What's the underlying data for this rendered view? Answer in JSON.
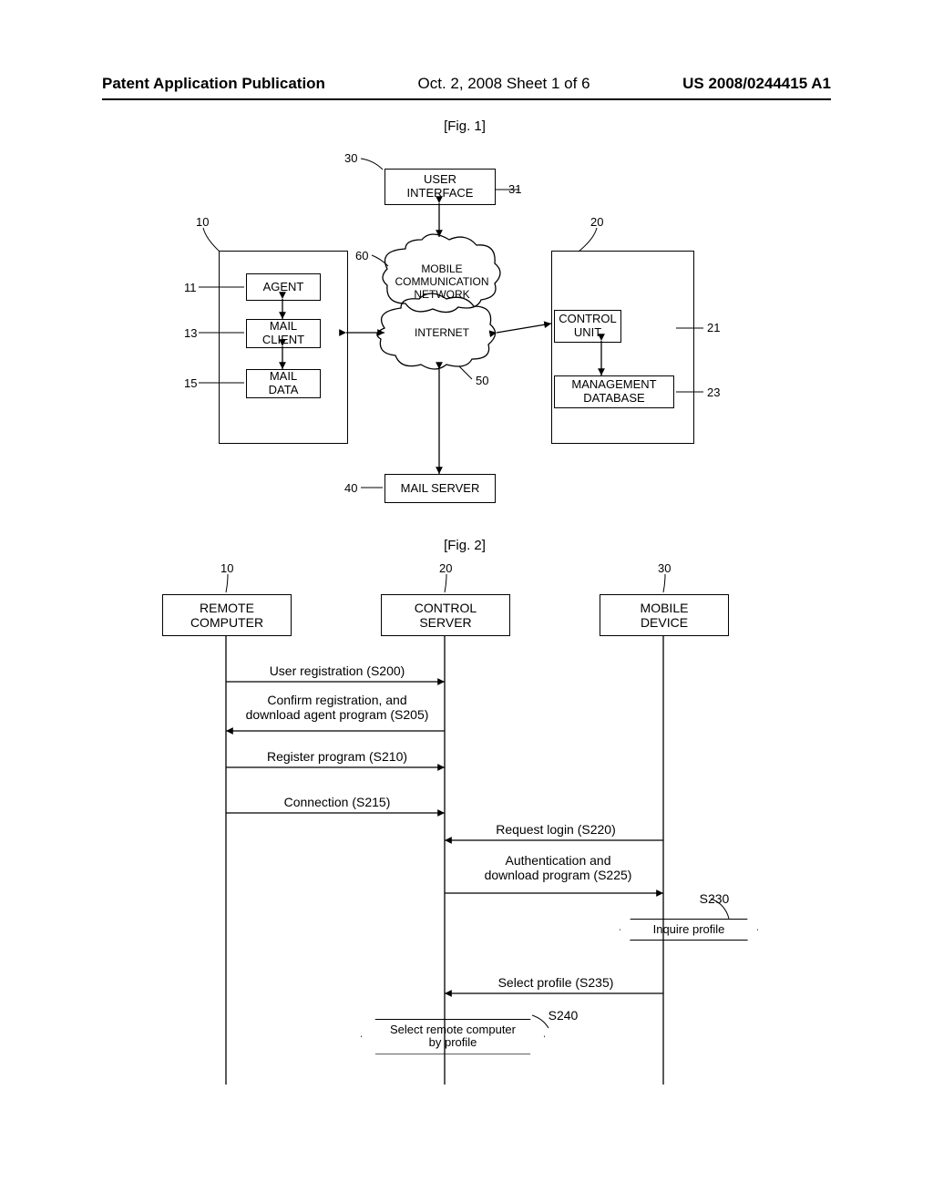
{
  "header": {
    "left": "Patent Application Publication",
    "mid": "Oct. 2, 2008  Sheet 1 of 6",
    "right": "US 2008/0244415 A1"
  },
  "fig1": {
    "title": "[Fig. 1]",
    "labels": {
      "n10": "10",
      "n11": "11",
      "n13": "13",
      "n15": "15",
      "n20": "20",
      "n21": "21",
      "n23": "23",
      "n30": "30",
      "n31": "31",
      "n40": "40",
      "n50": "50",
      "n60": "60"
    },
    "boxes": {
      "user_interface": "USER\nINTERFACE",
      "agent": "AGENT",
      "mail_client": "MAIL\nCLIENT",
      "mail_data": "MAIL\nDATA",
      "control_unit": "CONTROL\nUNIT",
      "mgmt_db": "MANAGEMENT\nDATABASE",
      "mail_server": "MAIL SERVER",
      "mobile_net": "MOBILE\nCOMMUNICATION\nNETWORK",
      "internet": "INTERNET"
    }
  },
  "fig2": {
    "title": "[Fig. 2]",
    "n10": "10",
    "n20": "20",
    "n30": "30",
    "remote": "REMOTE\nCOMPUTER",
    "control": "CONTROL\nSERVER",
    "mobile": "MOBILE\nDEVICE",
    "s200": "User registration  (S200)",
    "s205": "Confirm registration, and\ndownload agent program (S205)",
    "s210": "Register program (S210)",
    "s215": "Connection (S215)",
    "s220": "Request login (S220)",
    "s225": "Authentication and\ndownload program  (S225)",
    "s230": "S230",
    "inquire": "Inquire profile",
    "s235": "Select profile (S235)",
    "s240": "S240",
    "selremote": "Select remote computer\nby profile"
  }
}
